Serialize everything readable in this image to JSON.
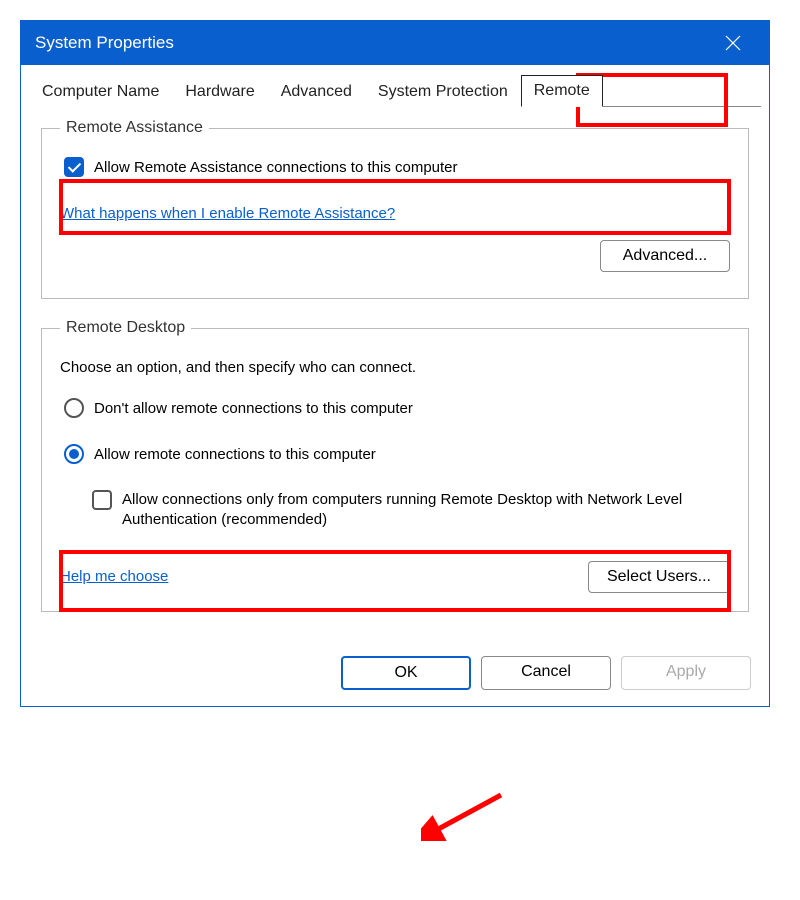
{
  "window": {
    "title": "System Properties"
  },
  "tabs": {
    "items": [
      {
        "label": "Computer Name",
        "active": false
      },
      {
        "label": "Hardware",
        "active": false
      },
      {
        "label": "Advanced",
        "active": false
      },
      {
        "label": "System Protection",
        "active": false
      },
      {
        "label": "Remote",
        "active": true
      }
    ]
  },
  "remoteAssistance": {
    "legend": "Remote Assistance",
    "allowCheckbox": {
      "label": "Allow Remote Assistance connections to this computer",
      "checked": true
    },
    "helpLink": "What happens when I enable Remote Assistance?",
    "advancedButton": "Advanced..."
  },
  "remoteDesktop": {
    "legend": "Remote Desktop",
    "instruction": "Choose an option, and then specify who can connect.",
    "radios": {
      "dontAllow": {
        "label": "Don't allow remote connections to this computer",
        "selected": false
      },
      "allow": {
        "label": "Allow remote connections to this computer",
        "selected": true
      }
    },
    "nlaCheckbox": {
      "label": "Allow connections only from computers running Remote Desktop with Network Level Authentication (recommended)",
      "checked": false
    },
    "helpLink": "Help me choose",
    "selectUsersButton": "Select Users..."
  },
  "footer": {
    "ok": "OK",
    "cancel": "Cancel",
    "apply": "Apply"
  }
}
